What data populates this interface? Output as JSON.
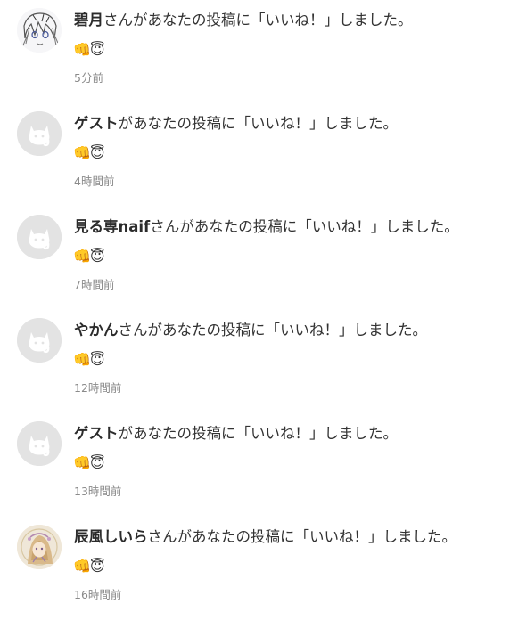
{
  "notifications": [
    {
      "name": "碧月",
      "text": "さんがあなたの投稿に「いいね！」しました。",
      "reaction": "👊😇",
      "time": "5分前",
      "avatar": "anime-drawing-avatar"
    },
    {
      "name": "ゲスト",
      "text": "があなたの投稿に「いいね！」しました。",
      "reaction": "👊😇",
      "time": "4時間前",
      "avatar": "default-cat-avatar"
    },
    {
      "name": "見る専naif",
      "text": "さんがあなたの投稿に「いいね！」しました。",
      "reaction": "👊😇",
      "time": "7時間前",
      "avatar": "default-cat-avatar"
    },
    {
      "name": "やかん",
      "text": "さんがあなたの投稿に「いいね！」しました。",
      "reaction": "👊😇",
      "time": "12時間前",
      "avatar": "default-cat-avatar"
    },
    {
      "name": "ゲスト",
      "text": "があなたの投稿に「いいね！」しました。",
      "reaction": "👊😇",
      "time": "13時間前",
      "avatar": "default-cat-avatar"
    },
    {
      "name": "辰風しいら",
      "text": "さんがあなたの投稿に「いいね！」しました。",
      "reaction": "👊😇",
      "time": "16時間前",
      "avatar": "character-illustration-avatar"
    }
  ],
  "colors": {
    "name_text": "#2b2b2b",
    "body_text": "#333333",
    "time_text": "#8a8a8a",
    "avatar_placeholder": "#e3e3e3"
  }
}
